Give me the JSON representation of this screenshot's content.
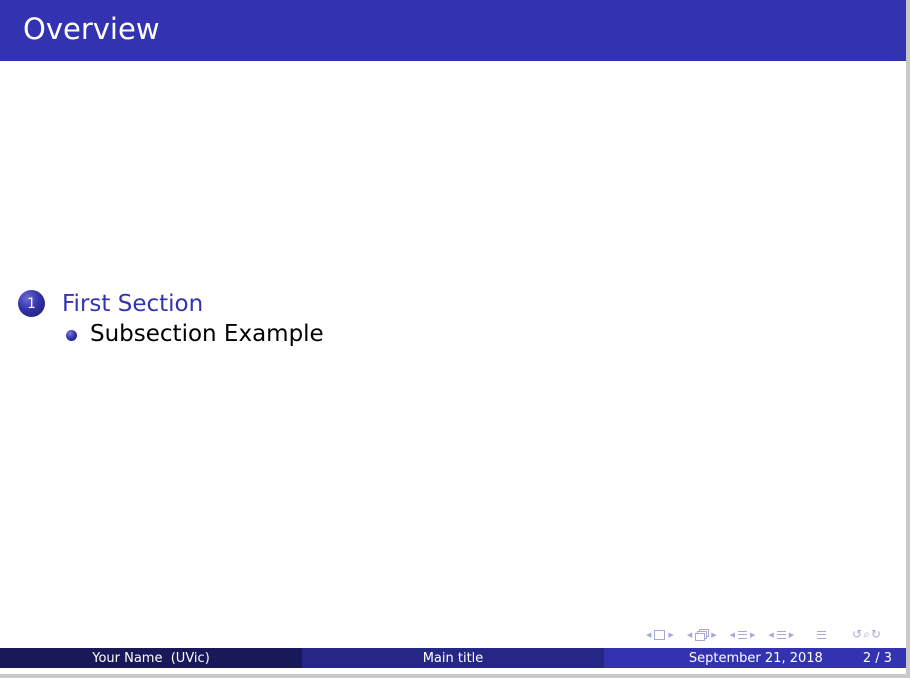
{
  "header": {
    "title": "Overview"
  },
  "toc": {
    "sections": [
      {
        "number": "1",
        "label": "First Section",
        "subsections": [
          "Subsection Example"
        ]
      }
    ]
  },
  "navigation": {
    "icons": [
      "nav-prev-arrow",
      "frame-icon",
      "nav-next-arrow",
      "subsection-icon",
      "section-icon",
      "toc-icon",
      "search-icon"
    ],
    "search_glyphs": "↺⌕↻"
  },
  "footer": {
    "author": "Your Name  (UVic)",
    "short_title": "Main title",
    "date": "September 21, 2018",
    "page": "2 / 3"
  },
  "colors": {
    "structure": "#3333b2",
    "footer_dark": "#191959",
    "footer_mid": "#262686",
    "text": "#000000"
  }
}
